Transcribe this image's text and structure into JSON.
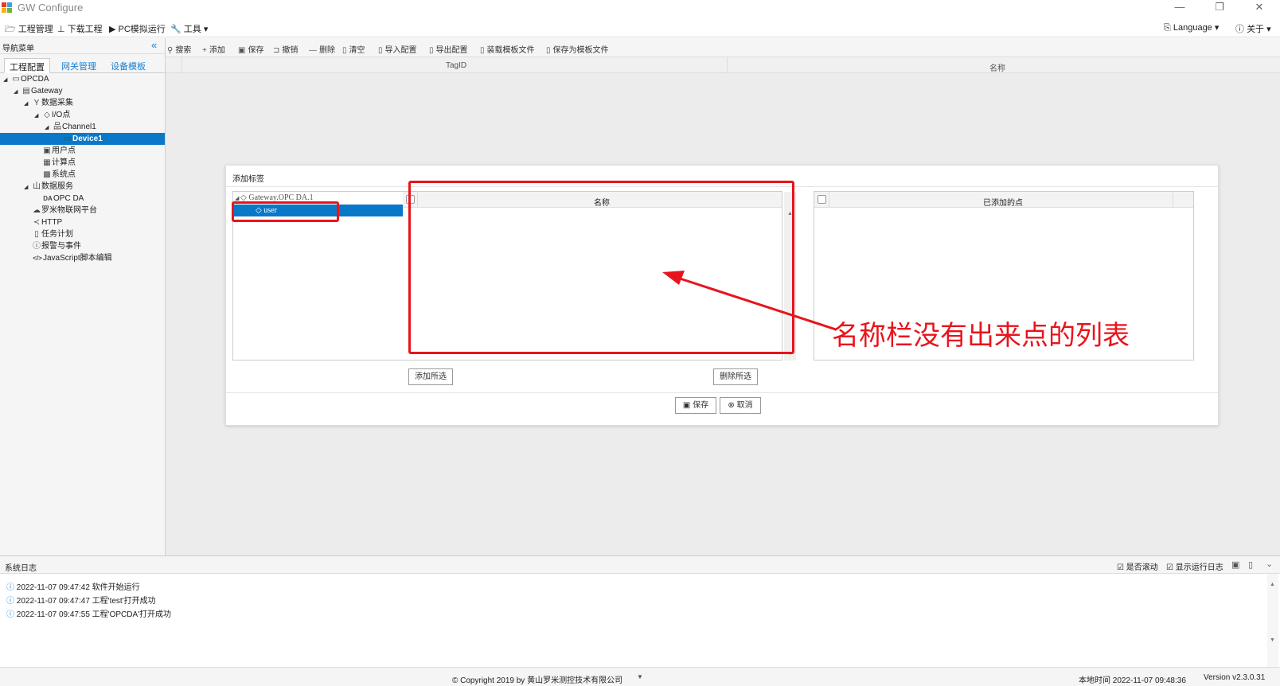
{
  "window": {
    "title": "GW Configure",
    "minimize": "—",
    "maximize": "❐",
    "close": "✕"
  },
  "menu": {
    "project": "工程管理",
    "download": "下载工程",
    "simulate": "PC模拟运行",
    "tools": "工具",
    "language": "Language",
    "about": "关于"
  },
  "nav": {
    "title": "导航菜单",
    "collapse": "«",
    "tabs": [
      "工程配置",
      "网关管理",
      "设备模板"
    ],
    "tree": [
      {
        "label": "OPCDA",
        "icon": "monitor-icon",
        "glyph": "▭",
        "toggle": "◢",
        "level": 0
      },
      {
        "label": "Gateway",
        "icon": "gateway-icon",
        "glyph": "▤",
        "toggle": "◢",
        "level": 1
      },
      {
        "label": "数据采集",
        "icon": "collect-icon",
        "glyph": "Y",
        "toggle": "◢",
        "level": 2
      },
      {
        "label": "I/O点",
        "icon": "tag-icon",
        "glyph": "◇",
        "toggle": "◢",
        "level": 3
      },
      {
        "label": "Channel1",
        "icon": "channel-icon",
        "glyph": "品",
        "toggle": "◢",
        "level": 4
      },
      {
        "label": "Device1",
        "icon": "device-icon",
        "glyph": "▭",
        "toggle": "",
        "level": 5,
        "selected": true
      },
      {
        "label": "用户点",
        "icon": "user-point-icon",
        "glyph": "▣",
        "toggle": "",
        "level": 3
      },
      {
        "label": "计算点",
        "icon": "calc-point-icon",
        "glyph": "▦",
        "toggle": "",
        "level": 3
      },
      {
        "label": "系统点",
        "icon": "system-point-icon",
        "glyph": "▩",
        "toggle": "",
        "level": 3
      },
      {
        "label": "数据服务",
        "icon": "data-service-icon",
        "glyph": "山",
        "toggle": "◢",
        "level": 2
      },
      {
        "label": "OPC DA",
        "icon": "opcda-icon",
        "glyph": "DA",
        "toggle": "",
        "level": 3
      },
      {
        "label": "罗米物联网平台",
        "icon": "cloud-icon",
        "glyph": "☁",
        "toggle": "",
        "level": 2
      },
      {
        "label": "HTTP",
        "icon": "share-icon",
        "glyph": "≺",
        "toggle": "",
        "level": 2
      },
      {
        "label": "任务计划",
        "icon": "task-icon",
        "glyph": "▯",
        "toggle": "",
        "level": 2
      },
      {
        "label": "报警与事件",
        "icon": "alarm-icon",
        "glyph": "ⓘ",
        "toggle": "",
        "level": 2
      },
      {
        "label": "JavaScript脚本编辑",
        "icon": "code-icon",
        "glyph": "</>",
        "toggle": "",
        "level": 2
      }
    ]
  },
  "toolbar": {
    "items": [
      {
        "label": "搜索",
        "icon": "search-icon",
        "glyph": "⚲"
      },
      {
        "label": "添加",
        "icon": "plus-icon",
        "glyph": "+"
      },
      {
        "label": "保存",
        "icon": "save-icon",
        "glyph": "▣"
      },
      {
        "label": "撤销",
        "icon": "undo-icon",
        "glyph": "⊐"
      },
      {
        "label": "删除",
        "icon": "minus-icon",
        "glyph": "—"
      },
      {
        "label": "清空",
        "icon": "trash-icon",
        "glyph": "▯"
      },
      {
        "label": "导入配置",
        "icon": "import-icon",
        "glyph": "▯"
      },
      {
        "label": "导出配置",
        "icon": "export-icon",
        "glyph": "▯"
      },
      {
        "label": "装载模板文件",
        "icon": "load-template-icon",
        "glyph": "▯"
      },
      {
        "label": "保存为模板文件",
        "icon": "save-template-icon",
        "glyph": "▯"
      }
    ]
  },
  "grid": {
    "columns": [
      "TagID",
      "名称"
    ]
  },
  "dialog": {
    "title": "添加标签",
    "tree_root": "Gateway.OPC DA.1",
    "tree_child": "user",
    "name_column": "名称",
    "added_column": "已添加的点",
    "add_selected": "添加所选",
    "remove_selected": "删除所选",
    "save": "保存",
    "cancel": "取消"
  },
  "annotation": {
    "text": "名称栏没有出来点的列表",
    "color": "#e8141c"
  },
  "log": {
    "title": "系统日志",
    "auto_scroll": "是否滚动",
    "show_run_log": "显示运行日志",
    "entries": [
      "2022-11-07 09:47:42 软件开始运行",
      "2022-11-07 09:47:47 工程'test'打开成功",
      "2022-11-07 09:47:55 工程'OPCDA'打开成功"
    ]
  },
  "status": {
    "copyright": "© Copyright 2019 by 黄山罗米测控技术有限公司",
    "local_time": "本地时间 2022-11-07 09:48:36",
    "version": "Version v2.3.0.31"
  }
}
